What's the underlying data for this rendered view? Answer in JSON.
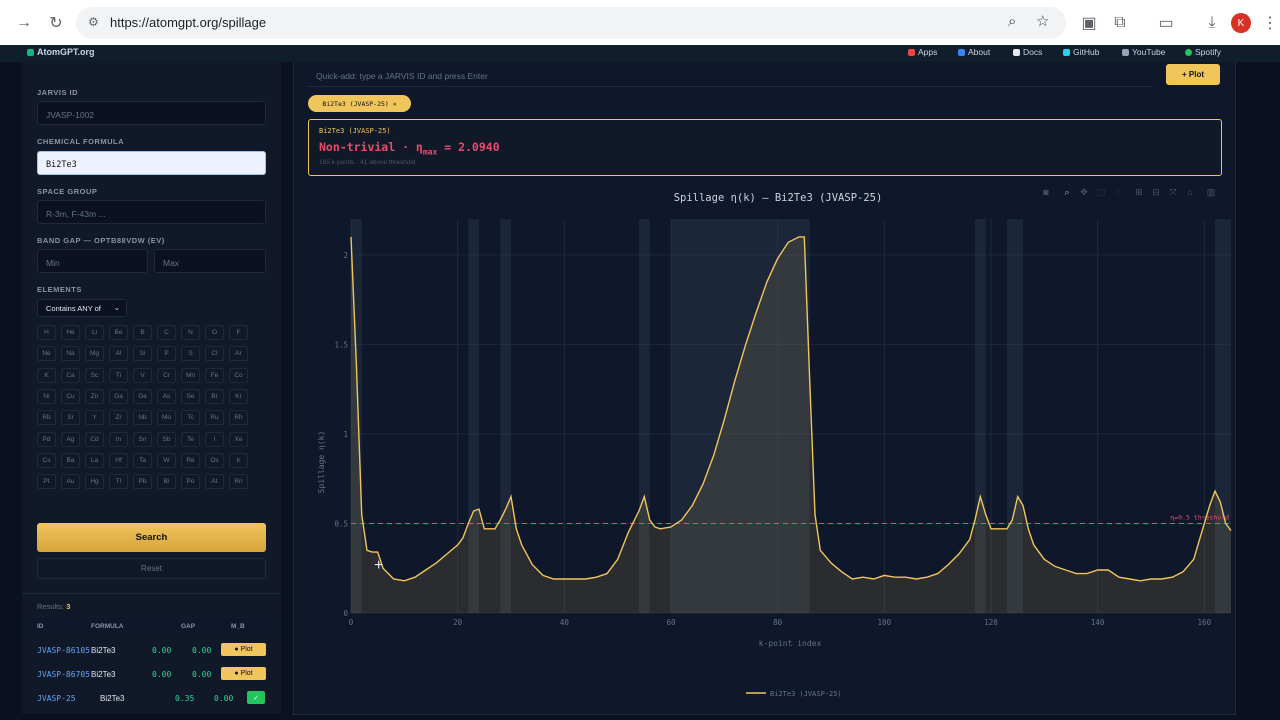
{
  "browser": {
    "url": "https://atomgpt.org/spillage",
    "avatar_letter": "K"
  },
  "bookmarks": {
    "site": "AtomGPT.org",
    "items": [
      "Apps",
      "About",
      "Docs",
      "GitHub",
      "YouTube",
      "Spotify"
    ]
  },
  "sidebar": {
    "jarvis_label": "JARVIS ID",
    "jarvis_placeholder": "JVASP-1002",
    "formula_label": "CHEMICAL FORMULA",
    "formula_value": "Bi2Te3",
    "spacegroup_label": "SPACE GROUP",
    "spacegroup_placeholder": "R-3m, F-43m ...",
    "bandgap_label": "BAND GAP — OPTB88VDW (EV)",
    "min_placeholder": "Min",
    "max_placeholder": "Max",
    "elements_label": "ELEMENTS",
    "elements_mode": "Contains ANY of",
    "elements": [
      [
        "H",
        "He",
        "Li",
        "Be",
        "B",
        "C",
        "N",
        "O",
        "F"
      ],
      [
        "Ne",
        "Na",
        "Mg",
        "Al",
        "Si",
        "P",
        "S",
        "Cl",
        "Ar"
      ],
      [
        "K",
        "Ca",
        "Sc",
        "Ti",
        "V",
        "Cr",
        "Mn",
        "Fe",
        "Co"
      ],
      [
        "Ni",
        "Cu",
        "Zn",
        "Ga",
        "Ge",
        "As",
        "Se",
        "Br",
        "Kr"
      ],
      [
        "Rb",
        "Sr",
        "Y",
        "Zr",
        "Nb",
        "Mo",
        "Tc",
        "Ru",
        "Rh"
      ],
      [
        "Pd",
        "Ag",
        "Cd",
        "In",
        "Sn",
        "Sb",
        "Te",
        "I",
        "Xe"
      ],
      [
        "Cs",
        "Ba",
        "La",
        "Hf",
        "Ta",
        "W",
        "Re",
        "Os",
        "Ir"
      ],
      [
        "Pt",
        "Au",
        "Hg",
        "Tl",
        "Pb",
        "Bi",
        "Po",
        "At",
        "Rn"
      ]
    ],
    "search_label": "Search",
    "reset_label": "Reset",
    "results_label": "Results:",
    "results_count": "3",
    "columns": [
      "ID",
      "FORMULA",
      "GAP",
      "M_B"
    ],
    "rows": [
      {
        "id": "JVASP-86105",
        "formula": "Bi2Te3",
        "gap": "0.00",
        "mb": "0.00",
        "action": "Plot"
      },
      {
        "id": "JVASP-86705",
        "formula": "Bi2Te3",
        "gap": "0.00",
        "mb": "0.00",
        "action": "Plot"
      },
      {
        "id": "JVASP-25",
        "formula": "Bi2Te3",
        "gap": "0.35",
        "mb": "0.00",
        "action": "✓"
      }
    ]
  },
  "main": {
    "quick_placeholder": "Quick-add: type a JARVIS ID and press Enter",
    "plot_button": "+ Plot",
    "chip_label": "Bi2Te3 (JVASP-25) ×",
    "card_title": "Bi2Te3 (JVASP-25)",
    "card_status": "Non-trivial · η",
    "card_sub": "max",
    "card_value": " = 2.0940",
    "card_meta": "165 k-points · 41 above threshold"
  },
  "chart_data": {
    "type": "line",
    "title": "Spillage η(k) — Bi2Te3 (JVASP-25)",
    "xlabel": "k-point index",
    "ylabel": "Spillage η(k)",
    "xlim": [
      0,
      165
    ],
    "ylim": [
      0,
      2.2
    ],
    "xticks": [
      0,
      20,
      40,
      60,
      80,
      100,
      120,
      140,
      160
    ],
    "yticks": [
      0,
      0.5,
      1,
      1.5,
      2
    ],
    "ytick_labels": [
      "0",
      "0.5",
      "1",
      "1.5",
      "2"
    ],
    "threshold": 0.5,
    "threshold_label": "η=0.5 threshold",
    "threshold_color": "#e74c6c",
    "line_color": "#f0c55c",
    "legend": "Bi2Te3 (JVASP-25)",
    "legend_position": "bottom-center",
    "grid": true,
    "series": [
      {
        "name": "Bi2Te3 (JVASP-25)",
        "x": [
          0,
          1,
          2,
          3,
          4,
          5,
          6,
          8,
          10,
          12,
          14,
          16,
          18,
          20,
          21,
          22,
          23,
          24,
          25,
          26,
          27,
          28,
          29,
          30,
          31,
          32,
          34,
          36,
          38,
          40,
          42,
          44,
          46,
          48,
          50,
          52,
          54,
          55,
          56,
          57,
          58,
          60,
          62,
          64,
          66,
          68,
          70,
          72,
          74,
          76,
          78,
          80,
          82,
          84,
          85,
          86,
          87,
          88,
          90,
          92,
          94,
          96,
          98,
          100,
          102,
          104,
          106,
          108,
          110,
          112,
          114,
          116,
          117,
          118,
          119,
          120,
          122,
          123,
          124,
          125,
          126,
          127,
          128,
          130,
          132,
          134,
          136,
          138,
          140,
          142,
          144,
          146,
          148,
          150,
          152,
          154,
          156,
          158,
          160,
          161,
          162,
          163,
          164,
          165
        ],
        "y": [
          2.1,
          1.4,
          0.55,
          0.35,
          0.34,
          0.34,
          0.25,
          0.19,
          0.18,
          0.2,
          0.24,
          0.28,
          0.33,
          0.38,
          0.42,
          0.5,
          0.57,
          0.58,
          0.47,
          0.47,
          0.47,
          0.52,
          0.58,
          0.65,
          0.47,
          0.38,
          0.27,
          0.21,
          0.19,
          0.19,
          0.19,
          0.19,
          0.2,
          0.22,
          0.3,
          0.45,
          0.57,
          0.65,
          0.52,
          0.48,
          0.47,
          0.48,
          0.52,
          0.6,
          0.72,
          0.88,
          1.08,
          1.3,
          1.5,
          1.68,
          1.85,
          1.98,
          2.07,
          2.1,
          2.1,
          1.3,
          0.55,
          0.35,
          0.28,
          0.23,
          0.19,
          0.2,
          0.19,
          0.21,
          0.2,
          0.2,
          0.19,
          0.2,
          0.22,
          0.27,
          0.33,
          0.41,
          0.52,
          0.65,
          0.55,
          0.47,
          0.47,
          0.47,
          0.52,
          0.65,
          0.6,
          0.47,
          0.38,
          0.3,
          0.26,
          0.24,
          0.22,
          0.22,
          0.24,
          0.24,
          0.2,
          0.19,
          0.18,
          0.19,
          0.19,
          0.2,
          0.23,
          0.3,
          0.5,
          0.6,
          0.68,
          0.62,
          0.5,
          0.46
        ]
      }
    ],
    "shaded_spans": [
      [
        0,
        2
      ],
      [
        22,
        24
      ],
      [
        28,
        30
      ],
      [
        54,
        56
      ],
      [
        60,
        86
      ],
      [
        117,
        119
      ],
      [
        123,
        126
      ],
      [
        162,
        165
      ]
    ]
  }
}
